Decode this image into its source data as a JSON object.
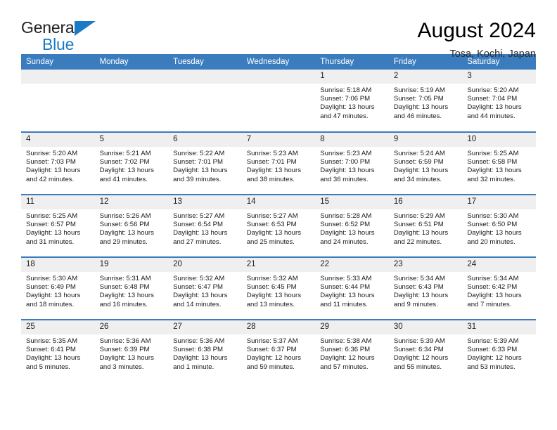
{
  "logo": {
    "word_top": "General",
    "word_bottom": "Blue",
    "triangle_color": "#1b7ac4"
  },
  "header": {
    "title": "August 2024",
    "subtitle": "Tosa, Kochi, Japan",
    "header_bg": "#3b7cbe",
    "daynum_bg": "#efefef"
  },
  "weekday_headers": [
    "Sunday",
    "Monday",
    "Tuesday",
    "Wednesday",
    "Thursday",
    "Friday",
    "Saturday"
  ],
  "weeks": [
    [
      {
        "day": "",
        "sunrise": "",
        "sunset": "",
        "daylight_line1": "",
        "daylight_line2": ""
      },
      {
        "day": "",
        "sunrise": "",
        "sunset": "",
        "daylight_line1": "",
        "daylight_line2": ""
      },
      {
        "day": "",
        "sunrise": "",
        "sunset": "",
        "daylight_line1": "",
        "daylight_line2": ""
      },
      {
        "day": "",
        "sunrise": "",
        "sunset": "",
        "daylight_line1": "",
        "daylight_line2": ""
      },
      {
        "day": "1",
        "sunrise": "Sunrise: 5:18 AM",
        "sunset": "Sunset: 7:06 PM",
        "daylight_line1": "Daylight: 13 hours",
        "daylight_line2": "and 47 minutes."
      },
      {
        "day": "2",
        "sunrise": "Sunrise: 5:19 AM",
        "sunset": "Sunset: 7:05 PM",
        "daylight_line1": "Daylight: 13 hours",
        "daylight_line2": "and 46 minutes."
      },
      {
        "day": "3",
        "sunrise": "Sunrise: 5:20 AM",
        "sunset": "Sunset: 7:04 PM",
        "daylight_line1": "Daylight: 13 hours",
        "daylight_line2": "and 44 minutes."
      }
    ],
    [
      {
        "day": "4",
        "sunrise": "Sunrise: 5:20 AM",
        "sunset": "Sunset: 7:03 PM",
        "daylight_line1": "Daylight: 13 hours",
        "daylight_line2": "and 42 minutes."
      },
      {
        "day": "5",
        "sunrise": "Sunrise: 5:21 AM",
        "sunset": "Sunset: 7:02 PM",
        "daylight_line1": "Daylight: 13 hours",
        "daylight_line2": "and 41 minutes."
      },
      {
        "day": "6",
        "sunrise": "Sunrise: 5:22 AM",
        "sunset": "Sunset: 7:01 PM",
        "daylight_line1": "Daylight: 13 hours",
        "daylight_line2": "and 39 minutes."
      },
      {
        "day": "7",
        "sunrise": "Sunrise: 5:23 AM",
        "sunset": "Sunset: 7:01 PM",
        "daylight_line1": "Daylight: 13 hours",
        "daylight_line2": "and 38 minutes."
      },
      {
        "day": "8",
        "sunrise": "Sunrise: 5:23 AM",
        "sunset": "Sunset: 7:00 PM",
        "daylight_line1": "Daylight: 13 hours",
        "daylight_line2": "and 36 minutes."
      },
      {
        "day": "9",
        "sunrise": "Sunrise: 5:24 AM",
        "sunset": "Sunset: 6:59 PM",
        "daylight_line1": "Daylight: 13 hours",
        "daylight_line2": "and 34 minutes."
      },
      {
        "day": "10",
        "sunrise": "Sunrise: 5:25 AM",
        "sunset": "Sunset: 6:58 PM",
        "daylight_line1": "Daylight: 13 hours",
        "daylight_line2": "and 32 minutes."
      }
    ],
    [
      {
        "day": "11",
        "sunrise": "Sunrise: 5:25 AM",
        "sunset": "Sunset: 6:57 PM",
        "daylight_line1": "Daylight: 13 hours",
        "daylight_line2": "and 31 minutes."
      },
      {
        "day": "12",
        "sunrise": "Sunrise: 5:26 AM",
        "sunset": "Sunset: 6:56 PM",
        "daylight_line1": "Daylight: 13 hours",
        "daylight_line2": "and 29 minutes."
      },
      {
        "day": "13",
        "sunrise": "Sunrise: 5:27 AM",
        "sunset": "Sunset: 6:54 PM",
        "daylight_line1": "Daylight: 13 hours",
        "daylight_line2": "and 27 minutes."
      },
      {
        "day": "14",
        "sunrise": "Sunrise: 5:27 AM",
        "sunset": "Sunset: 6:53 PM",
        "daylight_line1": "Daylight: 13 hours",
        "daylight_line2": "and 25 minutes."
      },
      {
        "day": "15",
        "sunrise": "Sunrise: 5:28 AM",
        "sunset": "Sunset: 6:52 PM",
        "daylight_line1": "Daylight: 13 hours",
        "daylight_line2": "and 24 minutes."
      },
      {
        "day": "16",
        "sunrise": "Sunrise: 5:29 AM",
        "sunset": "Sunset: 6:51 PM",
        "daylight_line1": "Daylight: 13 hours",
        "daylight_line2": "and 22 minutes."
      },
      {
        "day": "17",
        "sunrise": "Sunrise: 5:30 AM",
        "sunset": "Sunset: 6:50 PM",
        "daylight_line1": "Daylight: 13 hours",
        "daylight_line2": "and 20 minutes."
      }
    ],
    [
      {
        "day": "18",
        "sunrise": "Sunrise: 5:30 AM",
        "sunset": "Sunset: 6:49 PM",
        "daylight_line1": "Daylight: 13 hours",
        "daylight_line2": "and 18 minutes."
      },
      {
        "day": "19",
        "sunrise": "Sunrise: 5:31 AM",
        "sunset": "Sunset: 6:48 PM",
        "daylight_line1": "Daylight: 13 hours",
        "daylight_line2": "and 16 minutes."
      },
      {
        "day": "20",
        "sunrise": "Sunrise: 5:32 AM",
        "sunset": "Sunset: 6:47 PM",
        "daylight_line1": "Daylight: 13 hours",
        "daylight_line2": "and 14 minutes."
      },
      {
        "day": "21",
        "sunrise": "Sunrise: 5:32 AM",
        "sunset": "Sunset: 6:45 PM",
        "daylight_line1": "Daylight: 13 hours",
        "daylight_line2": "and 13 minutes."
      },
      {
        "day": "22",
        "sunrise": "Sunrise: 5:33 AM",
        "sunset": "Sunset: 6:44 PM",
        "daylight_line1": "Daylight: 13 hours",
        "daylight_line2": "and 11 minutes."
      },
      {
        "day": "23",
        "sunrise": "Sunrise: 5:34 AM",
        "sunset": "Sunset: 6:43 PM",
        "daylight_line1": "Daylight: 13 hours",
        "daylight_line2": "and 9 minutes."
      },
      {
        "day": "24",
        "sunrise": "Sunrise: 5:34 AM",
        "sunset": "Sunset: 6:42 PM",
        "daylight_line1": "Daylight: 13 hours",
        "daylight_line2": "and 7 minutes."
      }
    ],
    [
      {
        "day": "25",
        "sunrise": "Sunrise: 5:35 AM",
        "sunset": "Sunset: 6:41 PM",
        "daylight_line1": "Daylight: 13 hours",
        "daylight_line2": "and 5 minutes."
      },
      {
        "day": "26",
        "sunrise": "Sunrise: 5:36 AM",
        "sunset": "Sunset: 6:39 PM",
        "daylight_line1": "Daylight: 13 hours",
        "daylight_line2": "and 3 minutes."
      },
      {
        "day": "27",
        "sunrise": "Sunrise: 5:36 AM",
        "sunset": "Sunset: 6:38 PM",
        "daylight_line1": "Daylight: 13 hours",
        "daylight_line2": "and 1 minute."
      },
      {
        "day": "28",
        "sunrise": "Sunrise: 5:37 AM",
        "sunset": "Sunset: 6:37 PM",
        "daylight_line1": "Daylight: 12 hours",
        "daylight_line2": "and 59 minutes."
      },
      {
        "day": "29",
        "sunrise": "Sunrise: 5:38 AM",
        "sunset": "Sunset: 6:36 PM",
        "daylight_line1": "Daylight: 12 hours",
        "daylight_line2": "and 57 minutes."
      },
      {
        "day": "30",
        "sunrise": "Sunrise: 5:39 AM",
        "sunset": "Sunset: 6:34 PM",
        "daylight_line1": "Daylight: 12 hours",
        "daylight_line2": "and 55 minutes."
      },
      {
        "day": "31",
        "sunrise": "Sunrise: 5:39 AM",
        "sunset": "Sunset: 6:33 PM",
        "daylight_line1": "Daylight: 12 hours",
        "daylight_line2": "and 53 minutes."
      }
    ]
  ]
}
